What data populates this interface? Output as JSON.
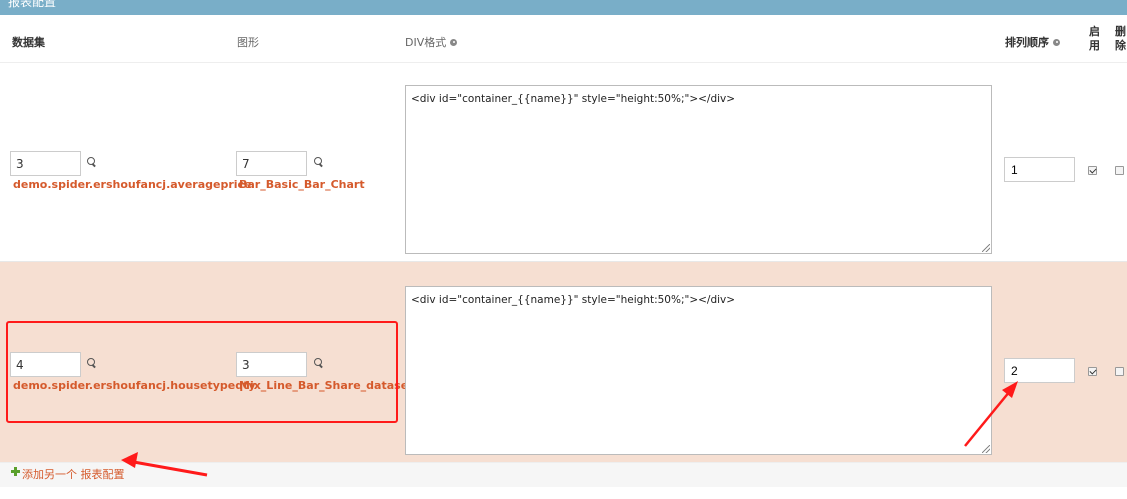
{
  "section": {
    "title": "报表配置"
  },
  "columns": {
    "dataset": "数据集",
    "chart": "图形",
    "div_format": "DIV格式",
    "sort_order": "排列顺序",
    "enabled_line1": "启",
    "enabled_line2": "用",
    "delete_line1": "删",
    "delete_line2": "除"
  },
  "rows": [
    {
      "dataset_id": "3",
      "dataset_name": "demo.spider.ershoufancj.averageprice",
      "chart_id": "7",
      "chart_name": "Bar_Basic_Bar_Chart",
      "div_format": "<div id=\"container_{{name}}\" style=\"height:50%;\"></div>",
      "sort_order": "1",
      "enabled": true,
      "delete": false
    },
    {
      "dataset_id": "4",
      "dataset_name": "demo.spider.ershoufancj.housetypeqty",
      "chart_id": "3",
      "chart_name": "Mix_Line_Bar_Share_dataset",
      "div_format": "<div id=\"container_{{name}}\" style=\"height:50%;\"></div>",
      "sort_order": "2",
      "enabled": true,
      "delete": false
    }
  ],
  "add_another": {
    "label": "添加另一个 报表配置"
  },
  "colors": {
    "header_bar": "#79aec8",
    "link": "#d55a2c",
    "selected_row": "#f6dfd2",
    "annotation": "#ff1a1a",
    "add_icon": "#5aa02c"
  }
}
